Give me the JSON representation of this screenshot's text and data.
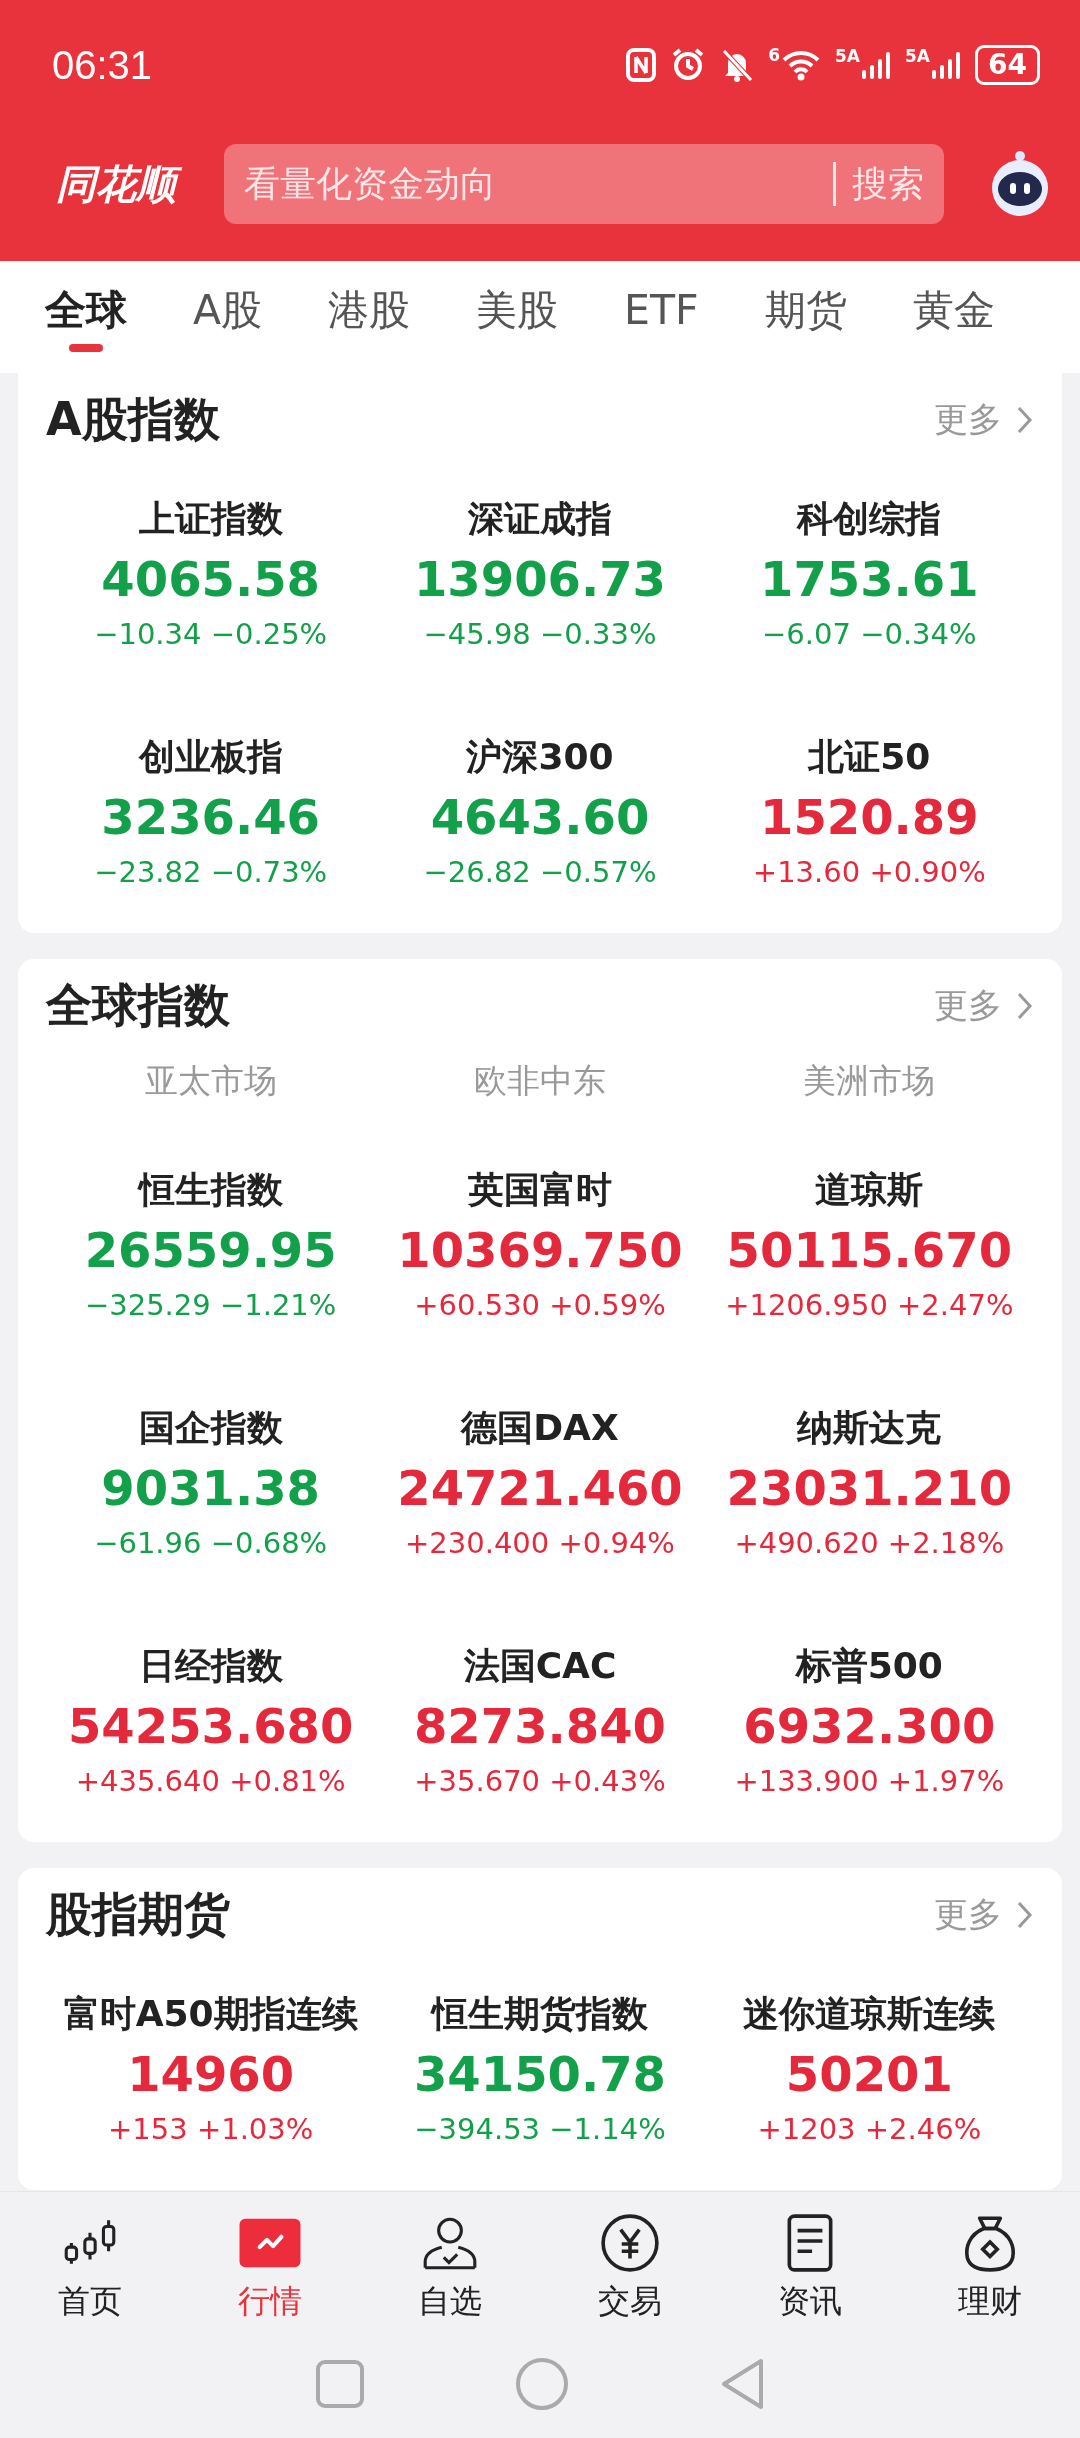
{
  "status_bar": {
    "time": "06:31",
    "wifi_label": "6",
    "signal_labels": [
      "5A",
      "5A"
    ],
    "battery": "64"
  },
  "header": {
    "logo": "同花顺",
    "search": {
      "placeholder": "看量化资金动向",
      "button": "搜索"
    }
  },
  "tabs": [
    {
      "label": "全球",
      "selected": true
    },
    {
      "label": "A股",
      "selected": false
    },
    {
      "label": "港股",
      "selected": false
    },
    {
      "label": "美股",
      "selected": false
    },
    {
      "label": "ETF",
      "selected": false
    },
    {
      "label": "期货",
      "selected": false
    },
    {
      "label": "黄金",
      "selected": false
    }
  ],
  "sections": [
    {
      "title": "A股指数",
      "more": "更多",
      "quotes": [
        {
          "name": "上证指数",
          "price": "4065.58",
          "change": "−10.34",
          "pct": "−0.25%",
          "color": "#13a04a"
        },
        {
          "name": "深证成指",
          "price": "13906.73",
          "change": "−45.98",
          "pct": "−0.33%",
          "color": "#13a04a"
        },
        {
          "name": "科创综指",
          "price": "1753.61",
          "change": "−6.07",
          "pct": "−0.34%",
          "color": "#13a04a"
        },
        {
          "name": "创业板指",
          "price": "3236.46",
          "change": "−23.82",
          "pct": "−0.73%",
          "color": "#13a04a"
        },
        {
          "name": "沪深300",
          "price": "4643.60",
          "change": "−26.82",
          "pct": "−0.57%",
          "color": "#13a04a"
        },
        {
          "name": "北证50",
          "price": "1520.89",
          "change": "+13.60",
          "pct": "+0.90%",
          "color": "#e5293c"
        }
      ]
    },
    {
      "title": "全球指数",
      "more": "更多",
      "regions": [
        "亚太市场",
        "欧非中东",
        "美洲市场"
      ],
      "quotes": [
        {
          "name": "恒生指数",
          "price": "26559.95",
          "change": "−325.29",
          "pct": "−1.21%",
          "color": "#13a04a"
        },
        {
          "name": "英国富时",
          "price": "10369.750",
          "change": "+60.530",
          "pct": "+0.59%",
          "color": "#e5293c"
        },
        {
          "name": "道琼斯",
          "price": "50115.670",
          "change": "+1206.950",
          "pct": "+2.47%",
          "color": "#e5293c"
        },
        {
          "name": "国企指数",
          "price": "9031.38",
          "change": "−61.96",
          "pct": "−0.68%",
          "color": "#13a04a"
        },
        {
          "name": "德国DAX",
          "price": "24721.460",
          "change": "+230.400",
          "pct": "+0.94%",
          "color": "#e5293c"
        },
        {
          "name": "纳斯达克",
          "price": "23031.210",
          "change": "+490.620",
          "pct": "+2.18%",
          "color": "#e5293c"
        },
        {
          "name": "日经指数",
          "price": "54253.680",
          "change": "+435.640",
          "pct": "+0.81%",
          "color": "#e5293c"
        },
        {
          "name": "法国CAC",
          "price": "8273.840",
          "change": "+35.670",
          "pct": "+0.43%",
          "color": "#e5293c"
        },
        {
          "name": "标普500",
          "price": "6932.300",
          "change": "+133.900",
          "pct": "+1.97%",
          "color": "#e5293c"
        }
      ]
    },
    {
      "title": "股指期货",
      "more": "更多",
      "quotes": [
        {
          "name": "富时A50期指连续",
          "price": "14960",
          "change": "+153",
          "pct": "+1.03%",
          "color": "#e5293c"
        },
        {
          "name": "恒生期货指数",
          "price": "34150.78",
          "change": "−394.53",
          "pct": "−1.14%",
          "color": "#13a04a"
        },
        {
          "name": "迷你道琼斯连续",
          "price": "50201",
          "change": "+1203",
          "pct": "+2.46%",
          "color": "#e5293c"
        }
      ]
    }
  ],
  "bottom_nav": [
    {
      "label": "首页",
      "kind": "candles",
      "selected": false
    },
    {
      "label": "行情",
      "kind": "chart",
      "selected": true
    },
    {
      "label": "自选",
      "kind": "person",
      "selected": false
    },
    {
      "label": "交易",
      "kind": "yen",
      "selected": false
    },
    {
      "label": "资讯",
      "kind": "doc",
      "selected": false
    },
    {
      "label": "理财",
      "kind": "bag",
      "selected": false
    }
  ]
}
